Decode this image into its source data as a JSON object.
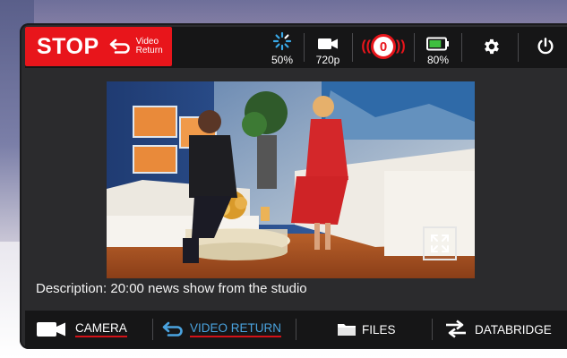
{
  "topbar": {
    "stop": {
      "label": "STOP",
      "sub_line1": "Video",
      "sub_line2": "Return"
    },
    "signal": {
      "value": "50%",
      "icon": "signal-spinner-icon"
    },
    "resolution": {
      "value": "720p",
      "icon": "video-camera-icon"
    },
    "recording": {
      "count": "0",
      "icon": "recording-indicator-icon"
    },
    "battery": {
      "value": "80%",
      "icon": "battery-icon",
      "level": 0.8
    },
    "settings": {
      "icon": "gear-icon"
    },
    "power": {
      "icon": "power-icon"
    }
  },
  "video": {
    "expand_icon": "expand-icon"
  },
  "description": "Description: 20:00 news show from the studio",
  "bottom_nav": [
    {
      "label": "CAMERA",
      "icon": "video-camera-icon"
    },
    {
      "label": "VIDEO RETURN",
      "icon": "return-arrow-icon"
    },
    {
      "label": "FILES",
      "icon": "folder-icon"
    },
    {
      "label": "DATABRIDGE",
      "icon": "transfer-arrows-icon"
    }
  ],
  "colors": {
    "accent_red": "#e8151b",
    "battery_green": "#3fbf3f",
    "link_blue": "#4aa3df",
    "bar_dark": "#161617"
  }
}
